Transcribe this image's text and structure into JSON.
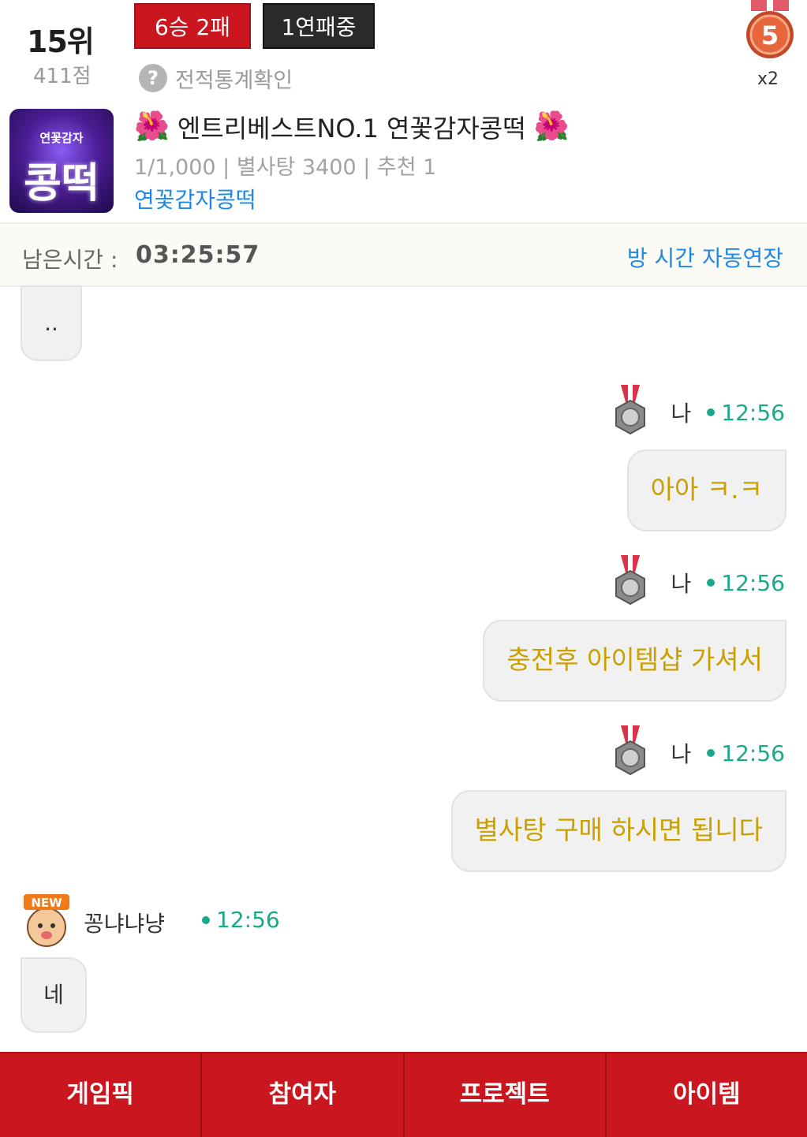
{
  "header": {
    "rank": "15위",
    "points": "411점",
    "record": "6승 2패",
    "streak": "1연패중",
    "stats_link": "전적통계확인",
    "stats_icon": "?",
    "medal_level": "5",
    "multiplier": "x2"
  },
  "room": {
    "thumb_sub": "연꽃감자",
    "thumb_main": "콩떡",
    "title": "엔트리베스트NO.1 연꽃감자콩떡",
    "flower_icon": "🌺",
    "meta": "1/1,000 | 별사탕 3400 | 추천 1",
    "owner": "연꽃감자콩떡"
  },
  "timer": {
    "label": "남은시간 :",
    "value": "03:25:57",
    "extend_link": "방 시간 자동연장"
  },
  "chat": {
    "messages": [
      {
        "text": ".."
      },
      {
        "sender": "나",
        "time": "12:56",
        "text": "아아 ㅋ.ㅋ"
      },
      {
        "sender": "나",
        "time": "12:56",
        "text": "충전후 아이템샵 가셔서"
      },
      {
        "sender": "나",
        "time": "12:56",
        "text": "별사탕 구매 하시면 됩니다"
      },
      {
        "sender": "꽁냐냐냥",
        "time": "12:56",
        "text": "네",
        "badge": "NEW"
      }
    ]
  },
  "nav": {
    "items": [
      "게임픽",
      "참여자",
      "프로젝트",
      "아이템"
    ]
  },
  "colors": {
    "brand_red": "#c9161f",
    "link_blue": "#1e88e5",
    "message_gold": "#c9a000",
    "timestamp_green": "#1aa88b"
  }
}
